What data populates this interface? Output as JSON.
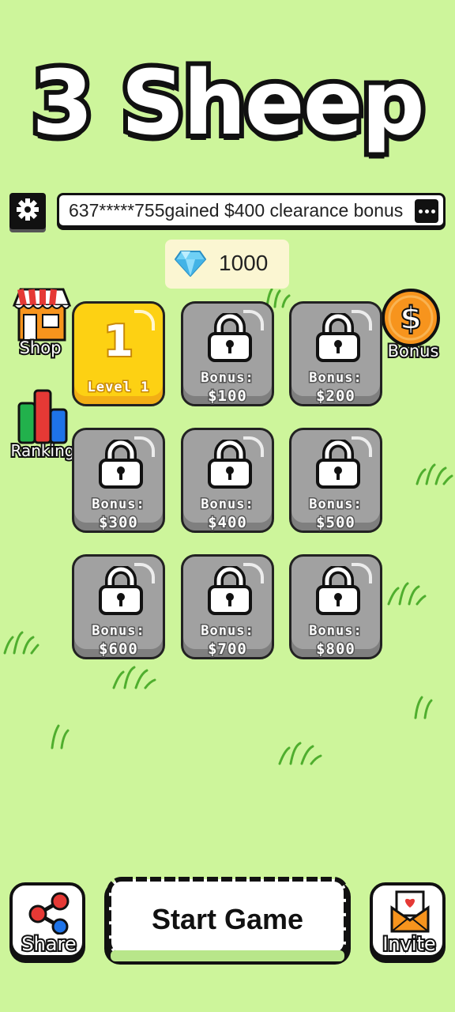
{
  "title": "3 Sheep",
  "ticker": {
    "text": "637*****755gained $400 clearance bonus"
  },
  "gems": {
    "count": "1000"
  },
  "side": {
    "shop": "Shop",
    "ranking": "Ranking",
    "bonus": "Bonus"
  },
  "levels": [
    {
      "locked": false,
      "number": "1",
      "name": "Level 1"
    },
    {
      "locked": true,
      "bonus_label": "Bonus:",
      "bonus_value": "$100"
    },
    {
      "locked": true,
      "bonus_label": "Bonus:",
      "bonus_value": "$200"
    },
    {
      "locked": true,
      "bonus_label": "Bonus:",
      "bonus_value": "$300"
    },
    {
      "locked": true,
      "bonus_label": "Bonus:",
      "bonus_value": "$400"
    },
    {
      "locked": true,
      "bonus_label": "Bonus:",
      "bonus_value": "$500"
    },
    {
      "locked": true,
      "bonus_label": "Bonus:",
      "bonus_value": "$600"
    },
    {
      "locked": true,
      "bonus_label": "Bonus:",
      "bonus_value": "$700"
    },
    {
      "locked": true,
      "bonus_label": "Bonus:",
      "bonus_value": "$800"
    }
  ],
  "bottom": {
    "share": "Share",
    "start": "Start Game",
    "invite": "Invite"
  },
  "colors": {
    "background": "#cdf59b",
    "unlocked_tile": "#fdd113",
    "locked_tile": "#a1a1a1",
    "bonus_coin": "#f7941d"
  }
}
